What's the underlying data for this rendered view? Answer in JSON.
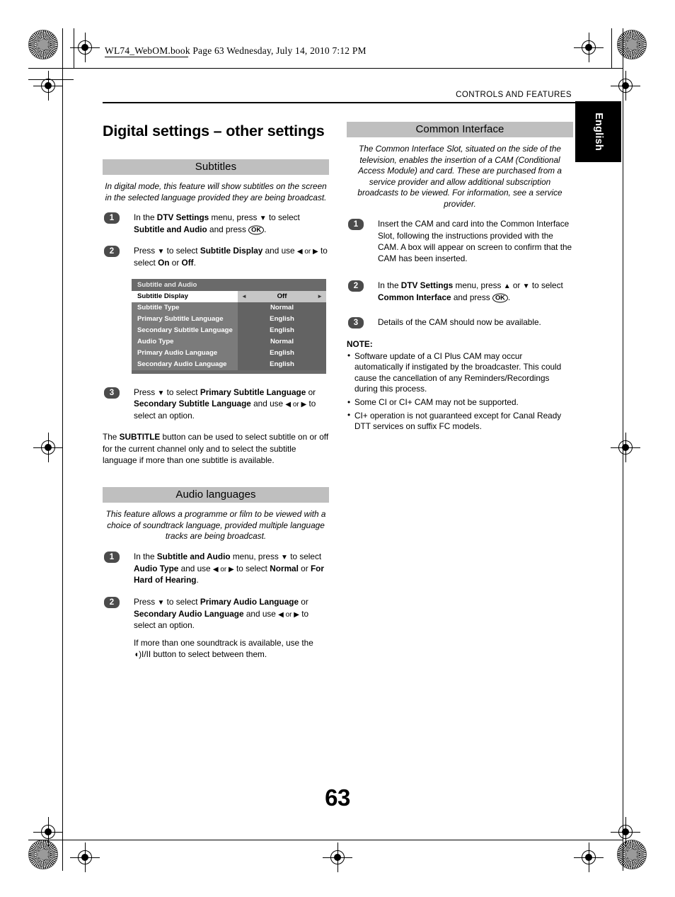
{
  "print_stamp": "WL74_WebOM.book  Page 63  Wednesday, July 14, 2010  7:12 PM",
  "running_head": "CONTROLS AND FEATURES",
  "language_tab": "English",
  "page_number": "63",
  "left_column": {
    "title": "Digital settings – other settings",
    "subtitles": {
      "heading": "Subtitles",
      "intro": "In digital mode, this feature will show subtitles on the screen in the selected language provided they are being broadcast.",
      "steps": [
        {
          "number": "1",
          "text_parts": [
            {
              "t": "In the ",
              "b": false
            },
            {
              "t": "DTV Settings",
              "b": true
            },
            {
              "t": " menu, press ",
              "b": false
            },
            {
              "t": "▼",
              "b": false
            },
            {
              "t": " to select ",
              "b": false
            },
            {
              "t": "Subtitle and Audio",
              "b": true
            },
            {
              "t": " and press ",
              "b": false
            },
            {
              "t": "OK",
              "b": false
            },
            {
              "t": ".",
              "b": false
            }
          ]
        },
        {
          "number": "2",
          "text_parts": [
            {
              "t": "Press ",
              "b": false
            },
            {
              "t": "▼",
              "b": false
            },
            {
              "t": " to select ",
              "b": false
            },
            {
              "t": "Subtitle Display",
              "b": true
            },
            {
              "t": " and use ",
              "b": false
            },
            {
              "t": "◀ or ▶",
              "b": false
            },
            {
              "t": " to select ",
              "b": false
            },
            {
              "t": "On",
              "b": true
            },
            {
              "t": " or ",
              "b": false
            },
            {
              "t": "Off",
              "b": true
            },
            {
              "t": ".",
              "b": false
            }
          ]
        },
        {
          "number": "3",
          "text_parts": [
            {
              "t": "Press ",
              "b": false
            },
            {
              "t": "▼",
              "b": false
            },
            {
              "t": " to select ",
              "b": false
            },
            {
              "t": "Primary Subtitle Language",
              "b": true
            },
            {
              "t": " or ",
              "b": false
            },
            {
              "t": "Secondary Subtitle Language",
              "b": true
            },
            {
              "t": " and use ",
              "b": false
            },
            {
              "t": "◀ or ▶",
              "b": false
            },
            {
              "t": " to select an option.",
              "b": false
            }
          ]
        }
      ],
      "closing_paragraph": "The SUBTITLE button can be used to select subtitle on or off for the current channel only and to select the subtitle language if more than one subtitle is available.",
      "closing_bold_token": "SUBTITLE"
    },
    "osd": {
      "title": "Subtitle and Audio",
      "rows": [
        {
          "label": "Subtitle Display",
          "value": "Off",
          "selected": true
        },
        {
          "label": "Subtitle Type",
          "value": "Normal",
          "selected": false
        },
        {
          "label": "Primary Subtitle Language",
          "value": "English",
          "selected": false
        },
        {
          "label": "Secondary Subtitle Language",
          "value": "English",
          "selected": false
        },
        {
          "label": "Audio Type",
          "value": "Normal",
          "selected": false
        },
        {
          "label": "Primary Audio Language",
          "value": "English",
          "selected": false
        },
        {
          "label": "Secondary Audio Language",
          "value": "English",
          "selected": false
        }
      ],
      "left_arrow": "◄",
      "right_arrow": "►"
    },
    "audio_languages": {
      "heading": "Audio languages",
      "intro": "This feature allows a programme or film to be viewed with a choice of soundtrack language, provided multiple language tracks are being broadcast.",
      "steps": [
        {
          "number": "1",
          "text_parts": [
            {
              "t": "In the ",
              "b": false
            },
            {
              "t": "Subtitle and Audio",
              "b": true
            },
            {
              "t": " menu, press ",
              "b": false
            },
            {
              "t": "▼",
              "b": false
            },
            {
              "t": " to select ",
              "b": false
            },
            {
              "t": "Audio Type",
              "b": true
            },
            {
              "t": " and use ",
              "b": false
            },
            {
              "t": "◀ or ▶",
              "b": false
            },
            {
              "t": " to select ",
              "b": false
            },
            {
              "t": "Normal",
              "b": true
            },
            {
              "t": " or ",
              "b": false
            },
            {
              "t": "For Hard of Hearing",
              "b": true
            },
            {
              "t": ".",
              "b": false
            }
          ]
        },
        {
          "number": "2",
          "text_parts": [
            {
              "t": "Press ",
              "b": false
            },
            {
              "t": "▼",
              "b": false
            },
            {
              "t": " to select ",
              "b": false
            },
            {
              "t": "Primary Audio Language",
              "b": true
            },
            {
              "t": " or ",
              "b": false
            },
            {
              "t": "Secondary Audio Language",
              "b": true
            },
            {
              "t": " and use ",
              "b": false
            },
            {
              "t": "◀ or ▶",
              "b": false
            },
            {
              "t": " to select an option.",
              "b": false
            }
          ]
        }
      ],
      "soundtrack_note_before": "If more than one soundtrack is available, use the ",
      "soundtrack_icon": "◖)I/II",
      "soundtrack_note_after": " button to select between them."
    }
  },
  "right_column": {
    "common_interface": {
      "heading": "Common Interface",
      "intro": "The Common Interface Slot, situated on the side of the television, enables the insertion of a CAM (Conditional Access Module) and card. These are purchased from a service provider and allow additional subscription broadcasts to be viewed. For information, see a service provider.",
      "steps": [
        {
          "number": "1",
          "text_parts": [
            {
              "t": "Insert the CAM and card into the Common Interface Slot, following the instructions provided with the CAM. A box will appear on screen to confirm that the CAM has been inserted.",
              "b": false
            }
          ]
        },
        {
          "number": "2",
          "text_parts": [
            {
              "t": "In the ",
              "b": false
            },
            {
              "t": "DTV Settings",
              "b": true
            },
            {
              "t": " menu, press ",
              "b": false
            },
            {
              "t": "▲",
              "b": false
            },
            {
              "t": " or ",
              "b": false
            },
            {
              "t": "▼",
              "b": false
            },
            {
              "t": " to select ",
              "b": false
            },
            {
              "t": "Common Interface",
              "b": true
            },
            {
              "t": " and press ",
              "b": false
            },
            {
              "t": "OK",
              "b": false
            },
            {
              "t": ".",
              "b": false
            }
          ]
        },
        {
          "number": "3",
          "text_parts": [
            {
              "t": "Details of the CAM should now be available.",
              "b": false
            }
          ]
        }
      ],
      "note_title": "NOTE:",
      "notes": [
        "Software update of a CI Plus CAM may occur automatically if instigated by the broadcaster. This could cause the cancellation of any Reminders/Recordings during this process.",
        "Some CI or CI+ CAM may not be supported.",
        "CI+ operation is not guaranteed except for Canal Ready DTT services on suffix FC models."
      ]
    }
  },
  "colors": {
    "band_gray": "#bfbfbf",
    "badge_gray": "#4b4b4b",
    "osd_label_gray": "#7b7b7b",
    "osd_value_gray": "#636363",
    "osd_selected_value": "#c6c6c6",
    "tab_black": "#000000"
  }
}
